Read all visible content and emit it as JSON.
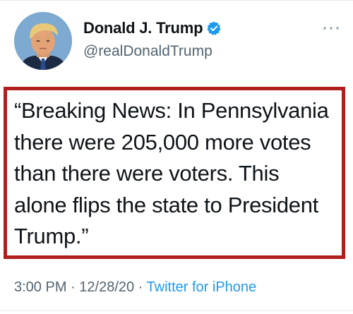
{
  "author": {
    "display_name": "Donald J. Trump",
    "handle": "@realDonaldTrump",
    "verified": true,
    "avatar_icon": "profile-photo-avatar"
  },
  "tweet": {
    "text": "“Breaking News: In Pennsylvania\nthere were 205,000 more votes\nthan there were voters. This\nalone flips the state to President\nTrump.”"
  },
  "meta": {
    "time": "3:00 PM",
    "separator": " · ",
    "date": "12/28/20",
    "source": "Twitter for iPhone"
  },
  "icons": {
    "verified": "verified-badge-icon",
    "more": "more-options-icon"
  },
  "colors": {
    "verified_blue": "#1d9bf0",
    "highlight_red": "#b01e1e",
    "secondary_text": "#536471",
    "link_blue": "#1d9bf0"
  }
}
